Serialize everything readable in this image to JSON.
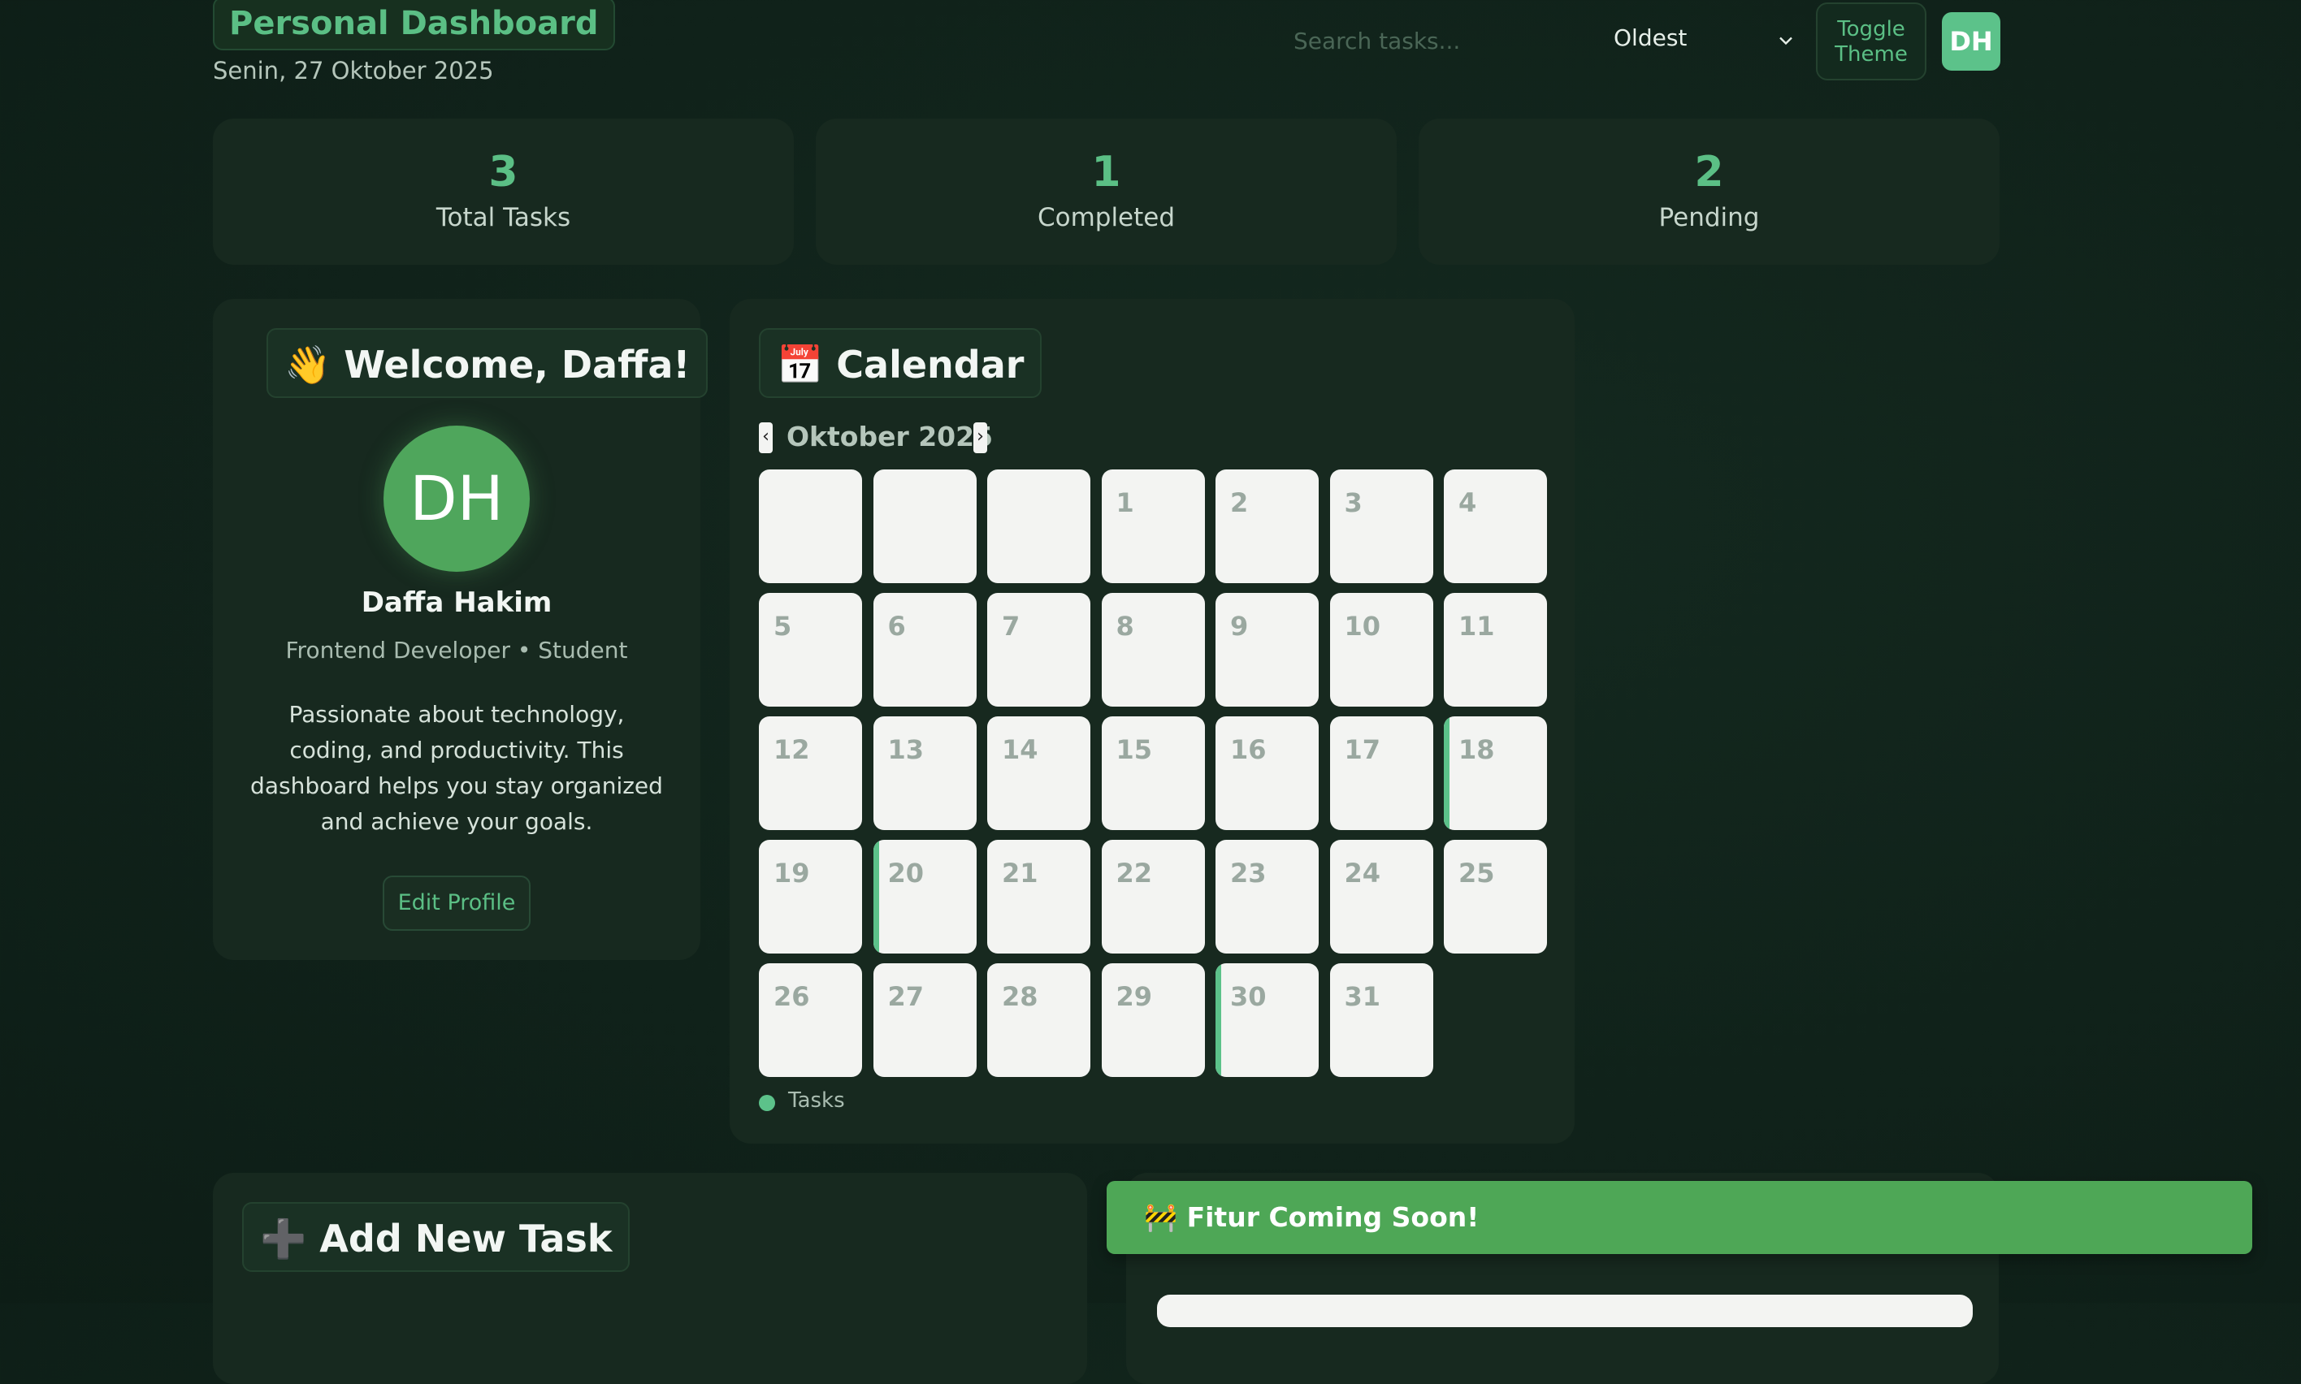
{
  "header": {
    "title": "Personal Dashboard",
    "date": "Senin, 27 Oktober 2025",
    "search_placeholder": "Search tasks...",
    "sort_value": "Oldest",
    "theme_button": "Toggle Theme",
    "avatar_initials": "DH"
  },
  "stats": [
    {
      "value": "3",
      "label": "Total Tasks"
    },
    {
      "value": "1",
      "label": "Completed"
    },
    {
      "value": "2",
      "label": "Pending"
    }
  ],
  "profile": {
    "title": "👋 Welcome, Daffa!",
    "initials": "DH",
    "name": "Daffa Hakim",
    "role": "Frontend Developer • Student",
    "bio": "Passionate about technology, coding, and productivity. This dashboard helps you stay organized and achieve your goals.",
    "edit_button": "Edit Profile"
  },
  "calendar": {
    "title": "📅 Calendar",
    "month": "Oktober 2025",
    "prev": "‹",
    "next": "›",
    "leading_blanks": 3,
    "days_in_month": 31,
    "task_days": [
      18,
      20,
      30
    ],
    "legend": "Tasks"
  },
  "add_task": {
    "title": "➕ Add New Task"
  },
  "toast": {
    "message": "🚧 Fitur Coming Soon!"
  },
  "colors": {
    "accent": "#5bbf85",
    "toast": "#4ea756",
    "background": "#10221a"
  }
}
